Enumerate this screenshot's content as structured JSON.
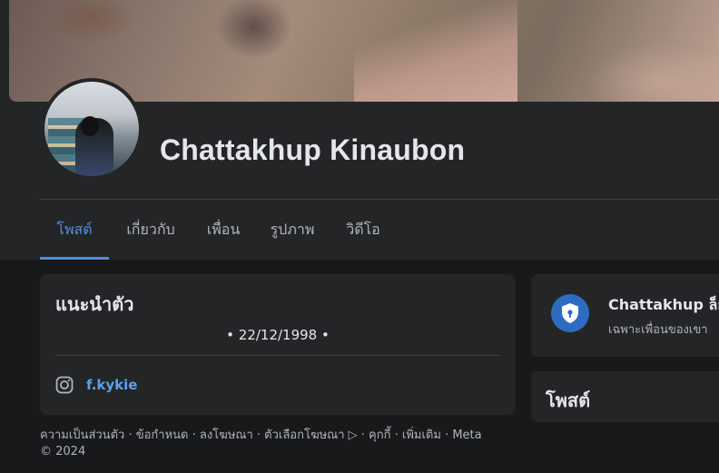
{
  "profile": {
    "name": "Chattakhup Kinaubon"
  },
  "tabs": [
    {
      "label": "โพสต์",
      "active": true
    },
    {
      "label": "เกี่ยวกับ",
      "active": false
    },
    {
      "label": "เพื่อน",
      "active": false
    },
    {
      "label": "รูปภาพ",
      "active": false
    },
    {
      "label": "วิดีโอ",
      "active": false
    }
  ],
  "intro": {
    "title": "แนะนำตัว",
    "bio": "• 22/12/1998 •",
    "instagram": {
      "icon": "instagram-icon",
      "handle": "f.kykie"
    }
  },
  "footer": {
    "line1": "ความเป็นส่วนตัว · ข้อกำหนด · ลงโฆษณา · ตัวเลือกโฆษณา ▷ · คุกกี้ · เพิ่มเติม · Meta",
    "line2": "© 2024"
  },
  "privacy": {
    "icon": "shield-lock-icon",
    "title": "Chattakhup ล็อ",
    "subtitle": "เฉพาะเพื่อนของเขา"
  },
  "posts": {
    "title": "โพสต์"
  },
  "colors": {
    "accent": "#4d8ee3",
    "link": "#5aa0ee",
    "card": "#242526",
    "background": "#18191a"
  }
}
